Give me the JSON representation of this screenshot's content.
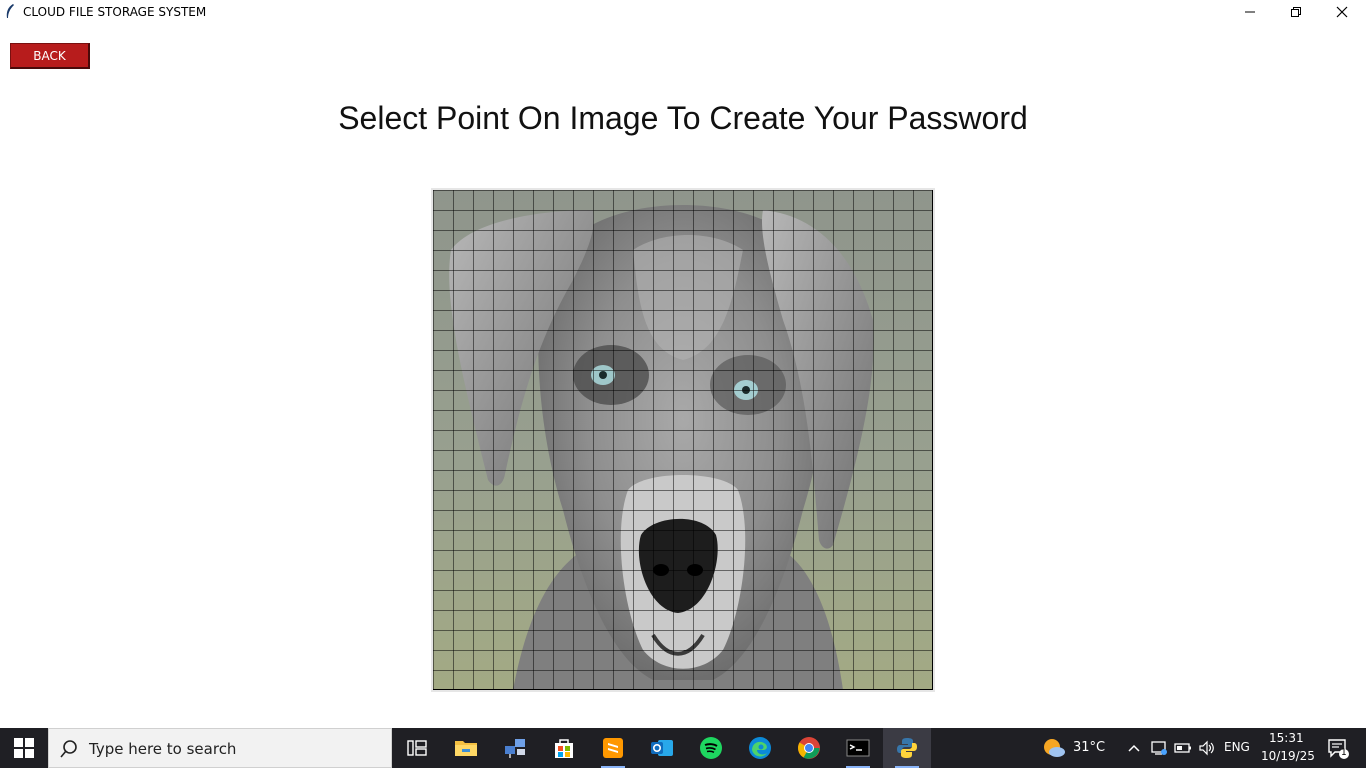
{
  "window": {
    "title": "CLOUD FILE STORAGE SYSTEM"
  },
  "page": {
    "back_label": "BACK",
    "heading": "Select Point On Image To Create Your Password"
  },
  "image": {
    "subject": "grayscale dog portrait",
    "grid_rows": 25,
    "grid_cols": 25
  },
  "taskbar": {
    "search_placeholder": "Type here to search",
    "apps": [
      "task-view",
      "file-explorer",
      "network-app",
      "microsoft-store",
      "sublime-text",
      "outlook",
      "spotify",
      "edge",
      "chrome",
      "terminal",
      "python"
    ],
    "weather": "31°C",
    "language": "ENG",
    "time": "15:31",
    "date": "10/19/25",
    "notification_count": "1"
  }
}
